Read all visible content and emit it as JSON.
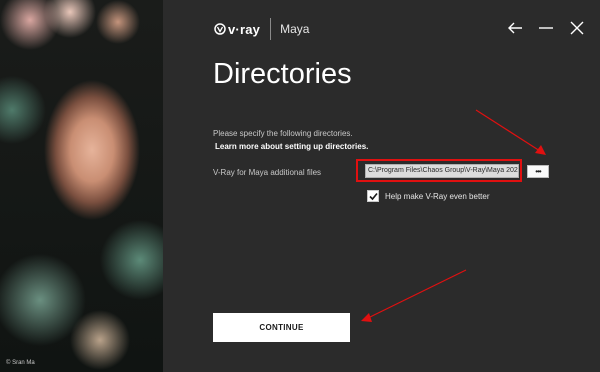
{
  "left_panel": {
    "credit": "© Sran Ma"
  },
  "header": {
    "brand": "v·ray",
    "product": "Maya"
  },
  "window_controls": {
    "back_icon": "arrow-left-icon",
    "minimize_icon": "minimize-icon",
    "close_icon": "close-icon"
  },
  "main": {
    "title": "Directories",
    "instructions": "Please specify the following directories.",
    "learn_link": "Learn more about setting up directories.",
    "field_label": "V-Ray for Maya additional files",
    "path_value": "C:\\Program Files\\Chaos Group\\V-Ray\\Maya 202",
    "browse_label": "•••",
    "checkbox_checked": true,
    "checkbox_label": "Help make V-Ray even better",
    "continue_label": "CONTINUE"
  },
  "colors": {
    "background": "#2b2b2b",
    "annotation_red": "#e01010"
  }
}
